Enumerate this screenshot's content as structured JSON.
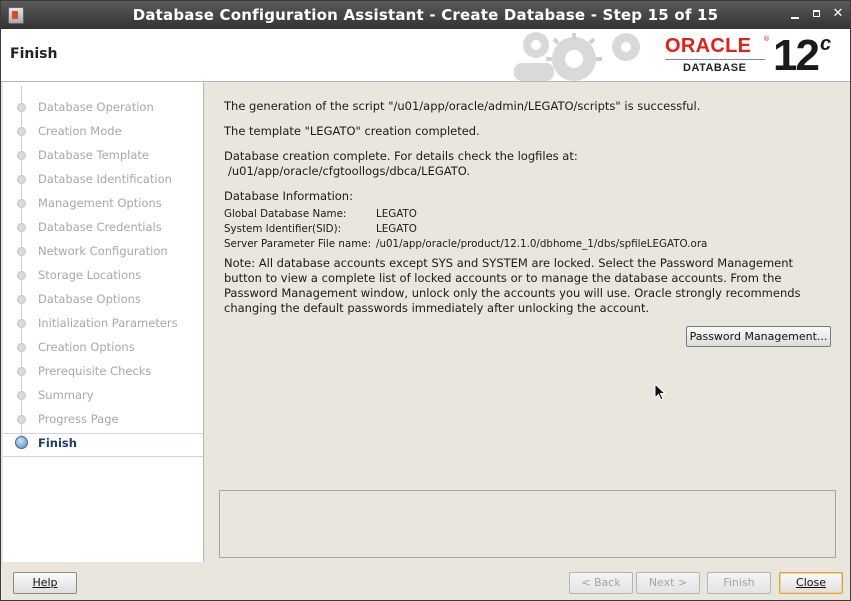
{
  "window": {
    "title": "Database Configuration Assistant - Create Database - Step 15 of 15"
  },
  "header": {
    "page_title": "Finish",
    "logo_word": "ORACLE",
    "logo_sub": "DATABASE",
    "version": "12",
    "version_suffix": "c"
  },
  "steps": [
    {
      "label": "Database Operation",
      "active": false
    },
    {
      "label": "Creation Mode",
      "active": false
    },
    {
      "label": "Database Template",
      "active": false
    },
    {
      "label": "Database Identification",
      "active": false
    },
    {
      "label": "Management Options",
      "active": false
    },
    {
      "label": "Database Credentials",
      "active": false
    },
    {
      "label": "Network Configuration",
      "active": false
    },
    {
      "label": "Storage Locations",
      "active": false
    },
    {
      "label": "Database Options",
      "active": false
    },
    {
      "label": "Initialization Parameters",
      "active": false
    },
    {
      "label": "Creation Options",
      "active": false
    },
    {
      "label": "Prerequisite Checks",
      "active": false
    },
    {
      "label": "Summary",
      "active": false
    },
    {
      "label": "Progress Page",
      "active": false
    },
    {
      "label": "Finish",
      "active": true
    }
  ],
  "content": {
    "script_msg": "The generation of the script \"/u01/app/oracle/admin/LEGATO/scripts\" is successful.",
    "template_msg": "The template \"LEGATO\" creation completed.",
    "complete_msg": "Database creation complete. For details check the logfiles at:",
    "log_path": "/u01/app/oracle/cfgtoollogs/dbca/LEGATO.",
    "info_heading": "Database Information:",
    "info": [
      {
        "key": "Global Database Name:",
        "value": "LEGATO"
      },
      {
        "key": "System Identifier(SID):",
        "value": "LEGATO"
      },
      {
        "key": "Server Parameter File name:",
        "value": "/u01/app/oracle/product/12.1.0/dbhome_1/dbs/spfileLEGATO.ora"
      }
    ],
    "note_lines": [
      "Note: All database accounts except SYS and SYSTEM are locked. Select the Password Management",
      "button to view a complete list of locked accounts or to manage the database accounts. From the",
      "Password Management window, unlock only the accounts you will use. Oracle strongly recommends",
      "changing the default passwords immediately after unlocking the account."
    ],
    "password_button": "Password Management..."
  },
  "footer": {
    "help": "Help",
    "back": "< Back",
    "next": "Next >",
    "finish": "Finish",
    "close": "Close"
  }
}
